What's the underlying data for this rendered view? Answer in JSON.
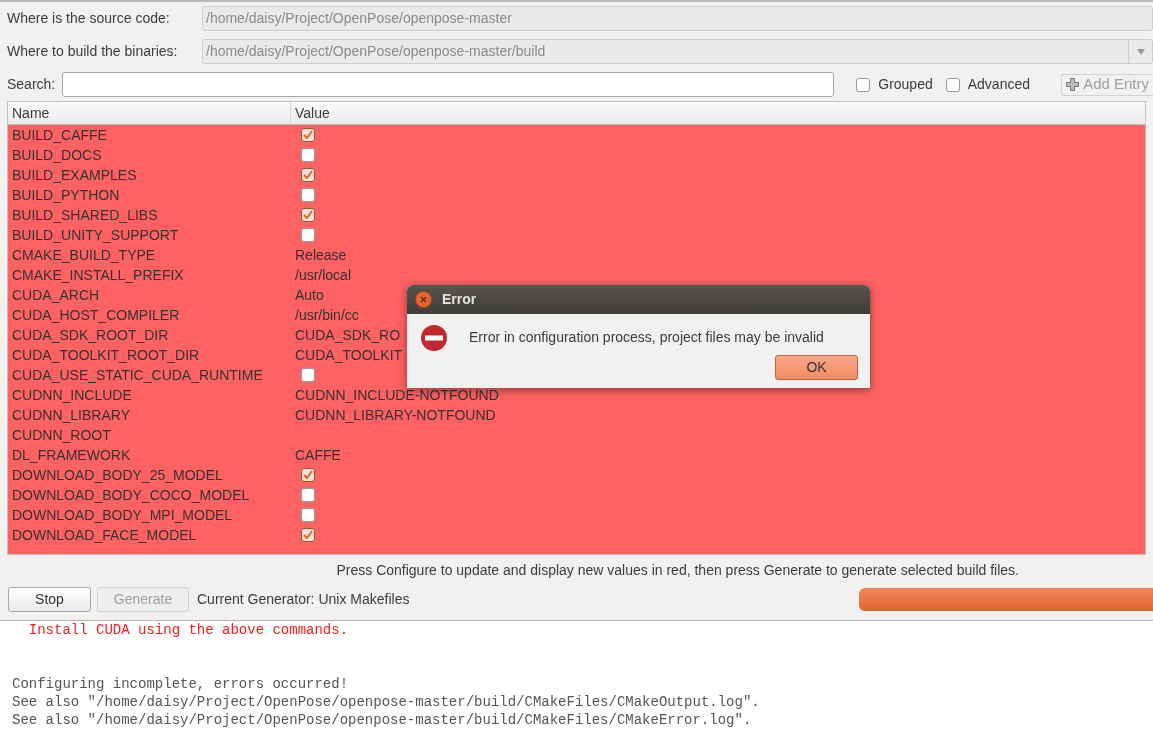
{
  "source": {
    "label": "Where is the source code:",
    "value": "/home/daisy/Project/OpenPose/openpose-master"
  },
  "build": {
    "label": "Where to build the binaries:",
    "value": "/home/daisy/Project/OpenPose/openpose-master/build"
  },
  "search": {
    "label": "Search:"
  },
  "options": [
    {
      "label": "Grouped",
      "checked": false
    },
    {
      "label": "Advanced",
      "checked": false
    }
  ],
  "add_entry": {
    "label": "Add Entry",
    "disabled": true
  },
  "table": {
    "columns": [
      "Name",
      "Value"
    ],
    "rows": [
      {
        "name": "BUILD_CAFFE",
        "kind": "checkbox",
        "checked": true
      },
      {
        "name": "BUILD_DOCS",
        "kind": "checkbox",
        "checked": false
      },
      {
        "name": "BUILD_EXAMPLES",
        "kind": "checkbox",
        "checked": true
      },
      {
        "name": "BUILD_PYTHON",
        "kind": "checkbox",
        "checked": false
      },
      {
        "name": "BUILD_SHARED_LIBS",
        "kind": "checkbox",
        "checked": true
      },
      {
        "name": "BUILD_UNITY_SUPPORT",
        "kind": "checkbox",
        "checked": false
      },
      {
        "name": "CMAKE_BUILD_TYPE",
        "kind": "text",
        "value": "Release"
      },
      {
        "name": "CMAKE_INSTALL_PREFIX",
        "kind": "text",
        "value": "/usr/local"
      },
      {
        "name": "CUDA_ARCH",
        "kind": "text",
        "value": "Auto"
      },
      {
        "name": "CUDA_HOST_COMPILER",
        "kind": "text",
        "value": "/usr/bin/cc"
      },
      {
        "name": "CUDA_SDK_ROOT_DIR",
        "kind": "text",
        "value": "CUDA_SDK_RO"
      },
      {
        "name": "CUDA_TOOLKIT_ROOT_DIR",
        "kind": "text",
        "value": "CUDA_TOOLKIT"
      },
      {
        "name": "CUDA_USE_STATIC_CUDA_RUNTIME",
        "kind": "checkbox",
        "checked": false
      },
      {
        "name": "CUDNN_INCLUDE",
        "kind": "text",
        "value": "CUDNN_INCLUDE-NOTFOUND"
      },
      {
        "name": "CUDNN_LIBRARY",
        "kind": "text",
        "value": "CUDNN_LIBRARY-NOTFOUND"
      },
      {
        "name": "CUDNN_ROOT",
        "kind": "text"
      },
      {
        "name": "DL_FRAMEWORK",
        "kind": "text",
        "value": "CAFFE"
      },
      {
        "name": "DOWNLOAD_BODY_25_MODEL",
        "kind": "checkbox",
        "checked": true
      },
      {
        "name": "DOWNLOAD_BODY_COCO_MODEL",
        "kind": "checkbox",
        "checked": false
      },
      {
        "name": "DOWNLOAD_BODY_MPI_MODEL",
        "kind": "checkbox",
        "checked": false
      },
      {
        "name": "DOWNLOAD_FACE_MODEL",
        "kind": "checkbox",
        "checked": true
      }
    ]
  },
  "hint": "Press Configure to update and display new values in red, then press Generate to generate selected build files.",
  "buttons": [
    {
      "label": "Stop",
      "disabled": false
    },
    {
      "label": "Generate",
      "disabled": true
    }
  ],
  "generator": "Current Generator: Unix Makefiles",
  "progress": {
    "level": 1
  },
  "log": [
    {
      "text": "  Install CUDA using the above commands.",
      "kind": "error"
    },
    {
      "kind": "blank"
    },
    {
      "kind": "blank"
    },
    {
      "text": "Configuring incomplete, errors occurred!",
      "kind": "info"
    },
    {
      "text": "See also \"/home/daisy/Project/OpenPose/openpose-master/build/CMakeFiles/CMakeOutput.log\".",
      "kind": "info"
    },
    {
      "text": "See also \"/home/daisy/Project/OpenPose/openpose-master/build/CMakeFiles/CMakeError.log\".",
      "kind": "info"
    }
  ],
  "dialog": {
    "title": "Error",
    "message": "Error in configuration process, project files may be invalid",
    "button": "OK"
  }
}
